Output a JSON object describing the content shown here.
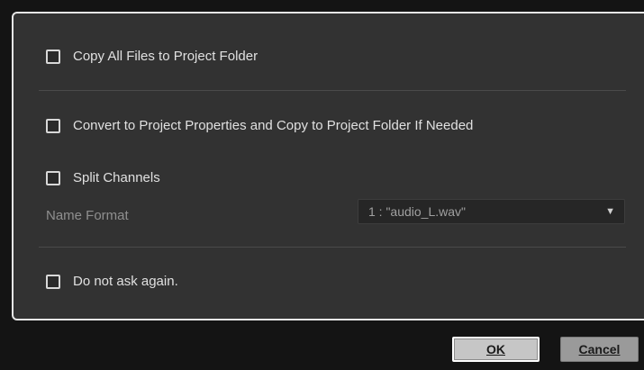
{
  "options": {
    "copy_all_files": {
      "label": "Copy All Files to Project Folder",
      "checked": false
    },
    "convert_and_copy": {
      "label": "Convert to Project Properties and Copy to Project Folder If Needed",
      "checked": false
    },
    "split_channels": {
      "label": "Split Channels",
      "checked": false
    },
    "do_not_ask": {
      "label": "Do not ask again.",
      "checked": false
    }
  },
  "name_format": {
    "label": "Name Format",
    "selected": "1 : \"audio_L.wav\""
  },
  "buttons": {
    "ok": "OK",
    "cancel": "Cancel"
  },
  "icons": {
    "dropdown_arrow": "chevron-down-icon"
  },
  "colors": {
    "background": "#141414",
    "panel": "#323232",
    "panel_border": "#e6e6e6",
    "text": "#e0e0e0",
    "muted_text": "#8f8f8f"
  }
}
